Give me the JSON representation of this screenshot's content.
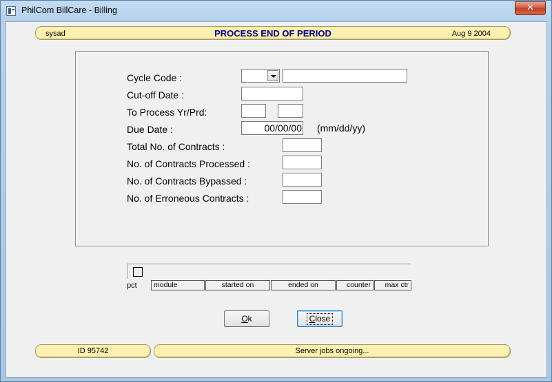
{
  "window": {
    "title": "PhilCom BillCare - Billing",
    "close_glyph": "✕"
  },
  "header": {
    "user": "sysad",
    "title": "PROCESS END OF PERIOD",
    "date": "Aug 9 2004"
  },
  "form": {
    "cycle_code_label": "Cycle Code :",
    "cycle_code_value": "",
    "cycle_code_desc": "",
    "cutoff_label": "Cut-off Date :",
    "cutoff_value": "",
    "process_label": "To Process Yr/Prd:",
    "process_year": "",
    "process_period": "",
    "due_date_label": "Due Date :",
    "due_date_value": "00/00/00",
    "due_date_hint": "(mm/dd/yy)",
    "total_contracts_label": "Total No. of Contracts :",
    "total_contracts_value": "",
    "processed_label": "No. of Contracts Processed :",
    "processed_value": "",
    "bypassed_label": "No. of Contracts Bypassed :",
    "bypassed_value": "",
    "erroneous_label": "No. of Erroneous Contracts :",
    "erroneous_value": ""
  },
  "progress": {
    "pct_label": "pct",
    "columns": [
      "module",
      "started on",
      "ended on",
      "counter",
      "max ctr"
    ]
  },
  "buttons": {
    "ok_label": "k",
    "ok_mnemonic": "O",
    "close_label": "lose",
    "close_mnemonic": "C"
  },
  "footer": {
    "id": "ID 95742",
    "status": "Server jobs ongoing..."
  },
  "icons": {
    "app": "app-window-icon",
    "dropdown": "chevron-down-icon",
    "close": "close-icon"
  }
}
